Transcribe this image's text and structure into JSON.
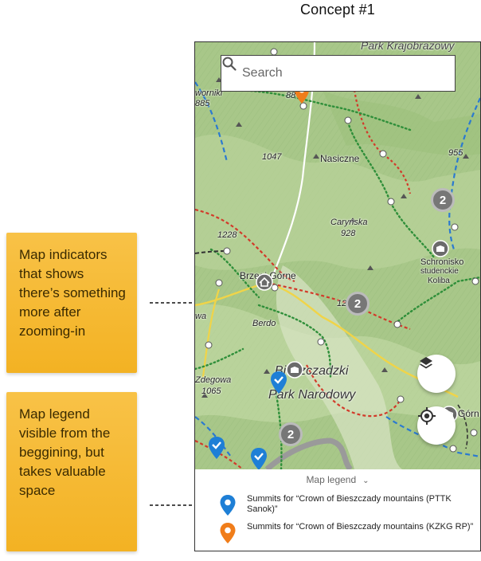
{
  "page_title": "Concept #1",
  "annotations": [
    {
      "text": "Map indicators that shows there’s something more after zooming-in"
    },
    {
      "text": "Map legend visible from the beggining, but takes valuable space"
    }
  ],
  "search": {
    "placeholder": "Search"
  },
  "map": {
    "labels": {
      "park_top": "Park Krajobrazowy",
      "num_885": "885",
      "num_88x": "88",
      "num_1047": "1047",
      "nasiczne": "Nasiczne",
      "num_955": "955",
      "carynska": "Caryńska",
      "num_928": "928",
      "num_1228": "1228",
      "schronisko": "Schronisko",
      "studenckie": "studenckie",
      "koliba": "Koliba",
      "brzegi": "Brzegi Górne",
      "num_12": "12",
      "berdo": "Berdo",
      "wa": "wa",
      "park1": "Bieszczadzki",
      "park2": "Park Narodowy",
      "zdegowa": "Zdegowa",
      "num_1065": "1065",
      "gorn": "Górn",
      "wyzniki": "worniki"
    },
    "clusters": [
      {
        "count": "2"
      },
      {
        "count": "2"
      },
      {
        "count": "2"
      }
    ],
    "colors": {
      "blue_pin": "#1e7fd6",
      "orange_pin": "#f07d1a",
      "cluster": "#777777",
      "terrain": "#a9c78a"
    }
  },
  "buttons": {
    "layers": "layers-icon",
    "locate": "my-location-icon"
  },
  "legend": {
    "heading": "Map legend",
    "items": [
      {
        "label": "Summits for “Crown of Bieszczady mountains (PTTK Sanok)”",
        "color": "#1e7fd6"
      },
      {
        "label": "Summits for “Crown of Bieszczady mountains (KZKG RP)”",
        "color": "#f07d1a"
      }
    ]
  }
}
